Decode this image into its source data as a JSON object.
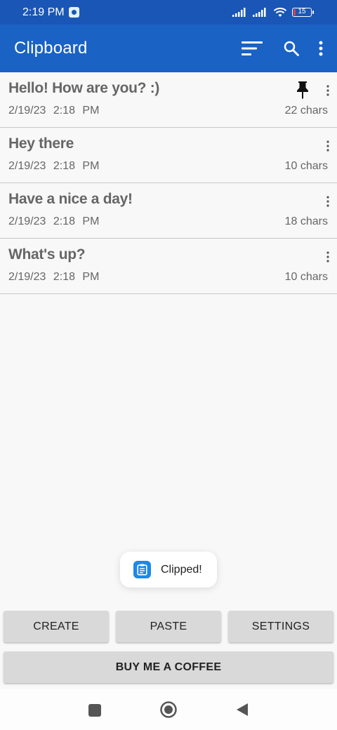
{
  "status_bar": {
    "time": "2:19 PM",
    "battery_percent": "15",
    "battery_level": 0.15,
    "battery_color": "#e34040"
  },
  "app_bar": {
    "title": "Clipboard",
    "icons": [
      "sort-icon",
      "search-icon",
      "more-vert-icon"
    ],
    "color": "#1a62c4"
  },
  "clips": [
    {
      "text": "Hello! How are you? :)",
      "date": "2/19/23 2:18 PM",
      "chars": "22 chars",
      "pinned": true
    },
    {
      "text": "Hey there",
      "date": "2/19/23 2:18 PM",
      "chars": "10 chars",
      "pinned": false
    },
    {
      "text": "Have a nice a day!",
      "date": "2/19/23 2:18 PM",
      "chars": "18 chars",
      "pinned": false
    },
    {
      "text": "What's up?",
      "date": "2/19/23 2:18 PM",
      "chars": "10 chars",
      "pinned": false
    }
  ],
  "toast": {
    "message": "Clipped!",
    "icon": "clipboard-icon"
  },
  "buttons": {
    "create": "CREATE",
    "paste": "PASTE",
    "settings": "SETTINGS",
    "coffee": "BUY ME A COFFEE"
  },
  "nav_bar": {
    "icons": [
      "recents-icon",
      "home-icon",
      "back-icon"
    ]
  }
}
